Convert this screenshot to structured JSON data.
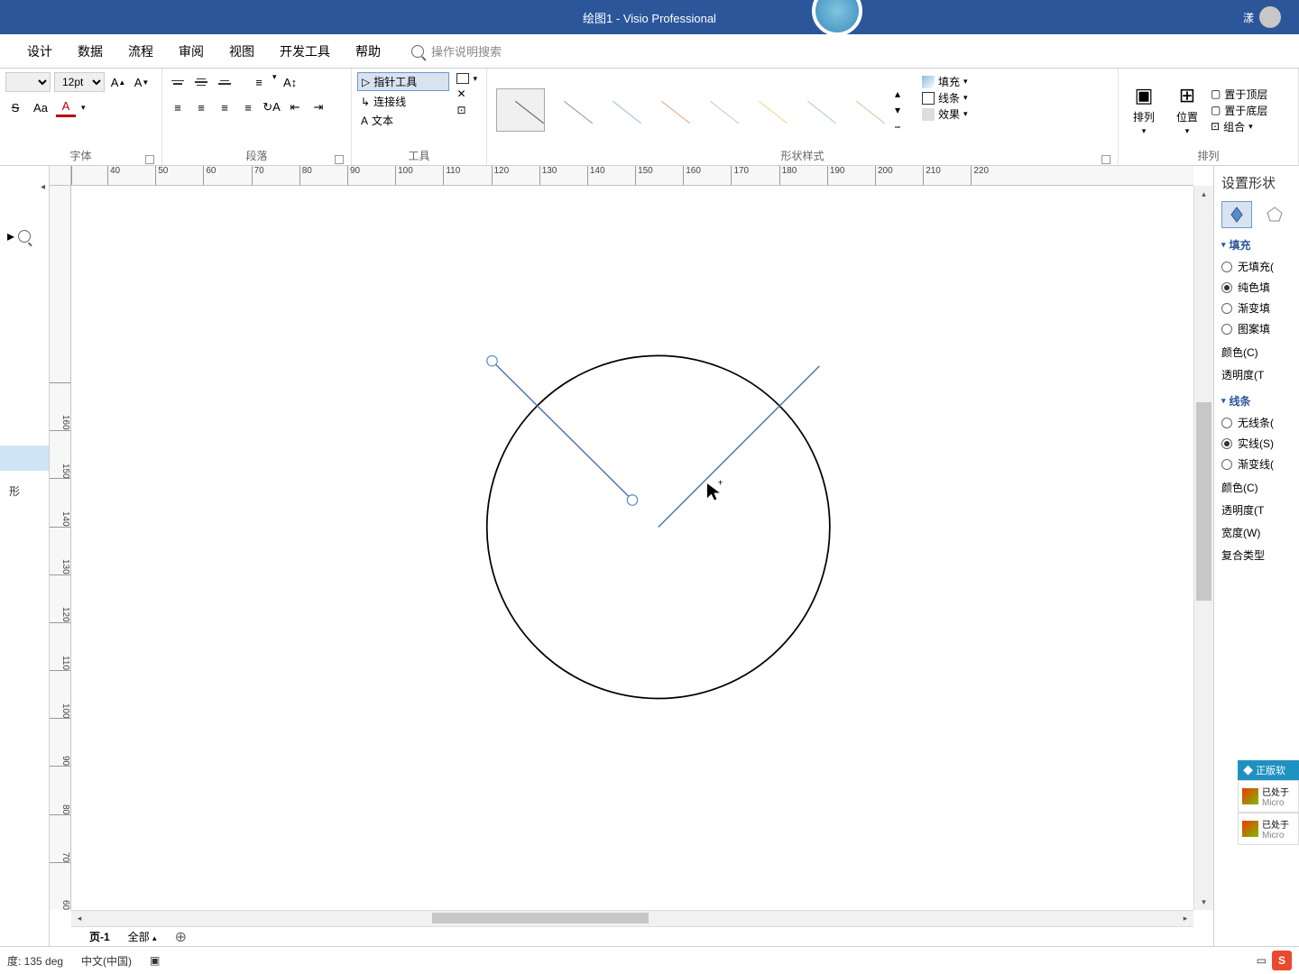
{
  "title": {
    "doc": "绘图1",
    "sep": " - ",
    "app": "Visio Professional"
  },
  "user_name": "漾",
  "menus": [
    "设计",
    "数据",
    "流程",
    "审阅",
    "视图",
    "开发工具",
    "帮助"
  ],
  "search_placeholder": "操作说明搜索",
  "ribbon": {
    "font": {
      "size": "12pt",
      "group": "字体"
    },
    "paragraph": {
      "group": "段落"
    },
    "tools": {
      "pointer": "指针工具",
      "connector": "连接线",
      "text": "文本",
      "group": "工具"
    },
    "styles": {
      "group": "形状样式"
    },
    "fill": {
      "fill": "填充",
      "line": "线条",
      "effect": "效果"
    },
    "arrange": {
      "arrange": "排列",
      "position": "位置",
      "group": "排列"
    },
    "stack": {
      "front": "置于顶层",
      "back": "置于底层",
      "grp": "组合"
    }
  },
  "ruler_h": [
    "40",
    "50",
    "60",
    "70",
    "80",
    "90",
    "100",
    "110",
    "120",
    "130",
    "140",
    "150",
    "160",
    "170",
    "180",
    "190",
    "200",
    "210",
    "220"
  ],
  "ruler_v": [
    "60",
    "70",
    "80",
    "90",
    "100",
    "110",
    "120",
    "130",
    "140",
    "150",
    "160"
  ],
  "shapes_pane": {
    "shape_label": "形"
  },
  "page_tabs": {
    "page1": "页-1",
    "all": "全部",
    "add": "+"
  },
  "format_pane": {
    "title": "设置形状",
    "section_fill": "填充",
    "fill_opts": [
      "无填充(",
      "纯色填",
      "渐变填",
      "图案填"
    ],
    "fill_selected": 1,
    "fill_color": "颜色(C)",
    "fill_trans": "透明度(T",
    "section_line": "线条",
    "line_opts": [
      "无线条(",
      "实线(S)",
      "渐变线("
    ],
    "line_selected": 1,
    "line_color": "颜色(C)",
    "line_trans": "透明度(T",
    "line_width": "宽度(W)",
    "line_compound": "复合类型"
  },
  "license": {
    "title": "正版软",
    "item1_a": "已处于",
    "item1_b": "Micro",
    "item2_a": "已处于",
    "item2_b": "Micro"
  },
  "status": {
    "angle": "度: 135 deg",
    "lang": "中文(中国)"
  }
}
